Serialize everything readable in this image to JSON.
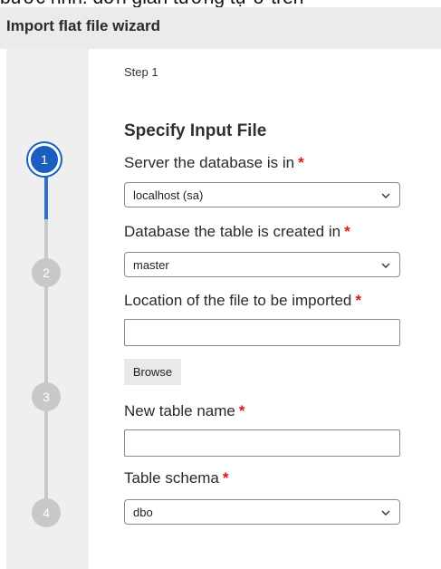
{
  "cropped_top_text": "bước nhh. đơn giản tương tự ở trên",
  "header": {
    "title": "Import flat file wizard"
  },
  "steps": [
    {
      "number": "1",
      "active": true
    },
    {
      "number": "2",
      "active": false
    },
    {
      "number": "3",
      "active": false
    },
    {
      "number": "4",
      "active": false
    }
  ],
  "step_label": "Step 1",
  "section_title": "Specify Input File",
  "required_marker": "*",
  "fields": {
    "server": {
      "label": "Server the database is in",
      "value": "localhost (sa)"
    },
    "database": {
      "label": "Database the table is created in",
      "value": "master"
    },
    "location": {
      "label": "Location of the file to be imported",
      "value": ""
    },
    "browse_label": "Browse",
    "table_name": {
      "label": "New table name",
      "value": ""
    },
    "schema": {
      "label": "Table schema",
      "value": "dbo"
    }
  },
  "colors": {
    "accent": "#1a5fbf",
    "required": "#e01616",
    "inactive_step": "#c8c8c8"
  },
  "icons": {
    "dropdown": "chevron-down-icon"
  }
}
